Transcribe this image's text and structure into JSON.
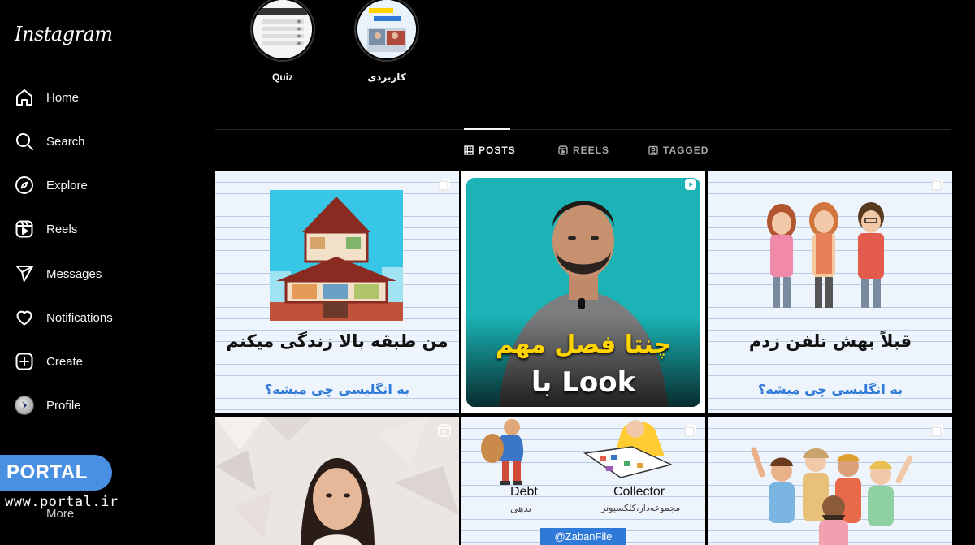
{
  "app": {
    "logo": "Instagram"
  },
  "sidebar": {
    "items": [
      {
        "label": "Home",
        "icon": "home-icon"
      },
      {
        "label": "Search",
        "icon": "search-icon"
      },
      {
        "label": "Explore",
        "icon": "explore-icon"
      },
      {
        "label": "Reels",
        "icon": "reels-icon"
      },
      {
        "label": "Messages",
        "icon": "messages-icon"
      },
      {
        "label": "Notifications",
        "icon": "heart-icon"
      },
      {
        "label": "Create",
        "icon": "create-icon"
      },
      {
        "label": "Profile",
        "icon": "avatar"
      }
    ],
    "more_label": "More"
  },
  "watermark": {
    "badge": "PORTAL",
    "url": "www.portal.ir"
  },
  "highlights": [
    {
      "label": "Quiz"
    },
    {
      "label": "کاربردی"
    }
  ],
  "tabs": [
    {
      "label": "POSTS",
      "active": true
    },
    {
      "label": "REELS",
      "active": false
    },
    {
      "label": "TAGGED",
      "active": false
    }
  ],
  "posts": [
    {
      "title": "من طبقه بالا زندگی میکنم",
      "subtitle": "به انگلیسی چی میشه؟",
      "type": "carousel"
    },
    {
      "title": "چنتا فصل مهم",
      "title2": "Look با",
      "type": "reel"
    },
    {
      "title": "قبلاً بهش تلفن زدم",
      "subtitle": "به انگلیسی چی میشه؟",
      "type": "carousel"
    },
    {
      "type": "reel"
    },
    {
      "word1": "Debt",
      "word1_fa": "بدهی",
      "word2": "Collector",
      "word2_fa": "مجموعه‌دار،کلکسیونر",
      "handle": "@ZabanFile",
      "type": "carousel"
    },
    {
      "type": "carousel"
    }
  ],
  "colors": {
    "accent": "#4a90e2",
    "reel_teal": "#1bb3b5",
    "title_yellow": "#ffd400",
    "subtitle_blue": "#2f7ad8"
  }
}
